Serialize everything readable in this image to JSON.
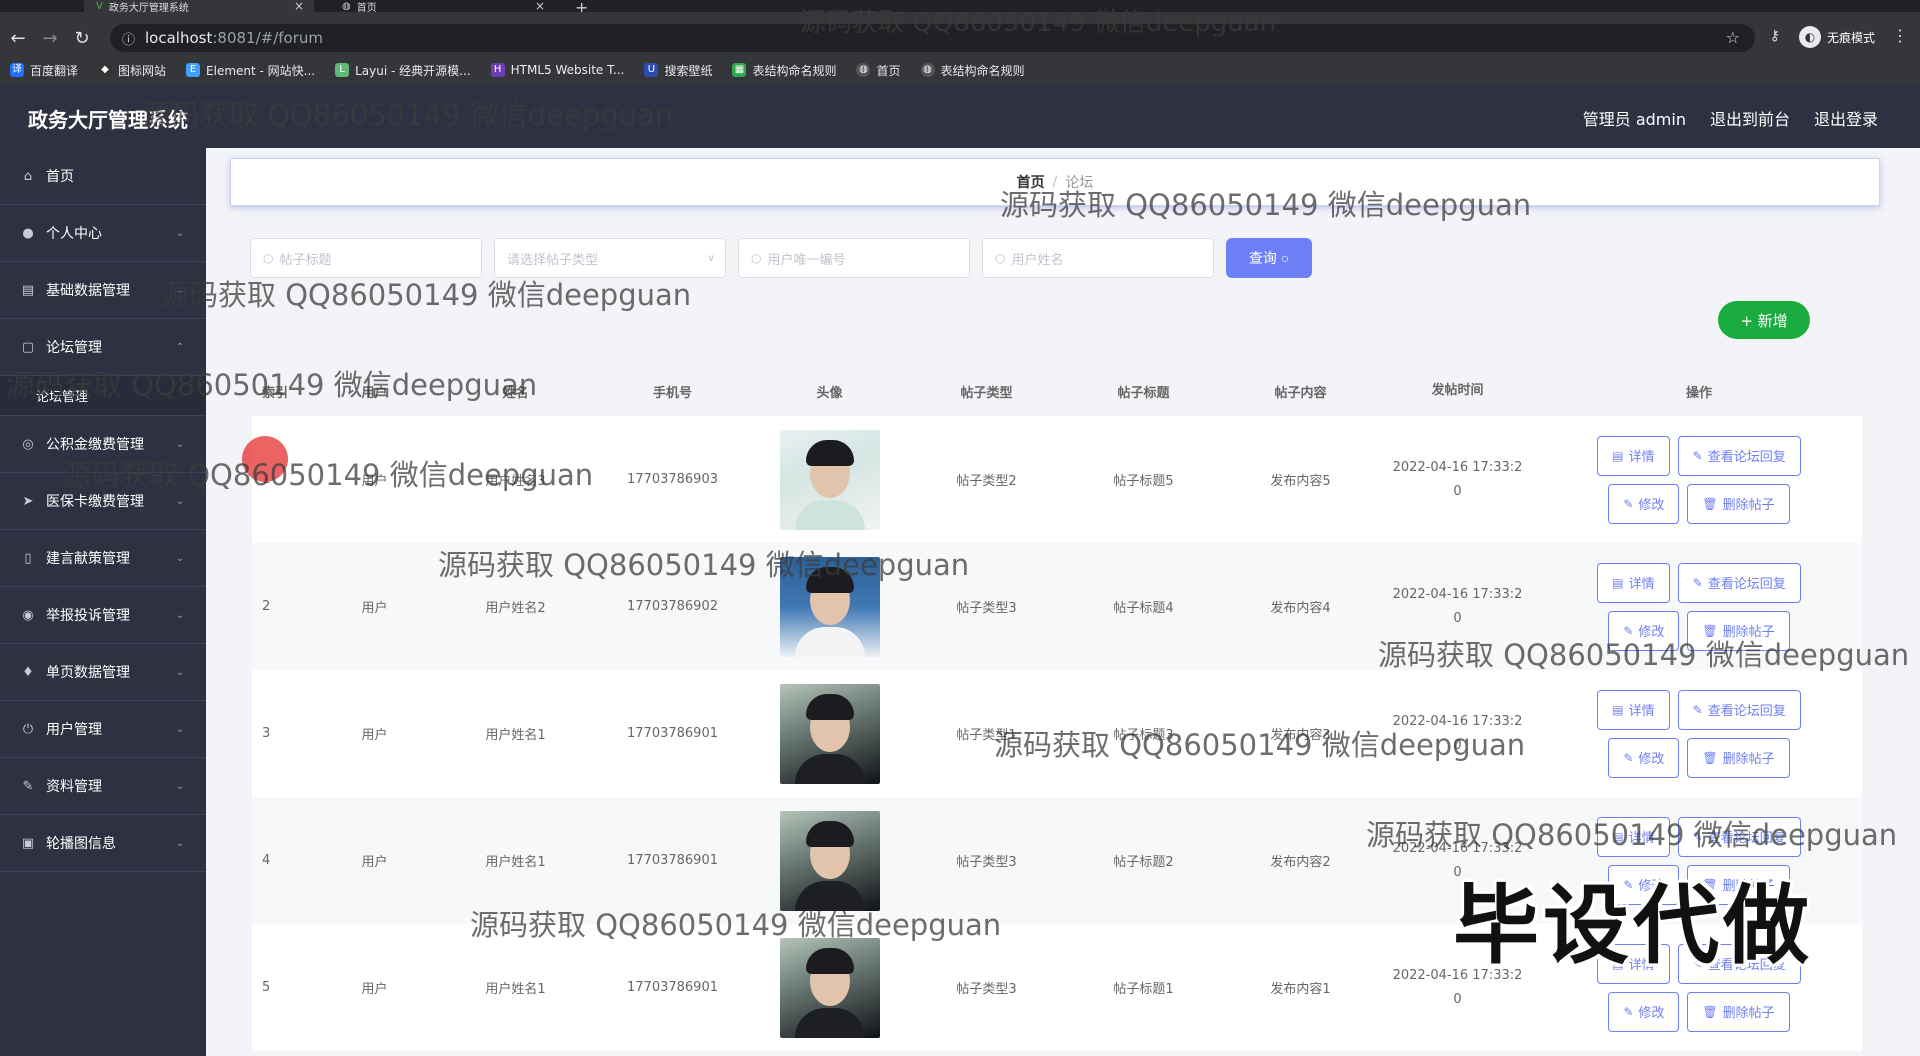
{
  "browser": {
    "tabs": [
      {
        "title": "政务大厅管理系统",
        "active": true
      },
      {
        "title": "首页",
        "active": false
      }
    ],
    "url": "localhost:8081/#/forum",
    "url_host": "localhost",
    "url_rest": ":8081/#/forum",
    "profile_label": "无痕模式",
    "bookmarks": [
      {
        "label": "百度翻译",
        "color": "#1e6fff"
      },
      {
        "label": "图标网站",
        "color": "#333333"
      },
      {
        "label": "Element - 网站快...",
        "color": "#409eff"
      },
      {
        "label": "Layui - 经典开源模...",
        "color": "#5fb878"
      },
      {
        "label": "HTML5 Website T...",
        "color": "#6c3fb5"
      },
      {
        "label": "搜索壁纸",
        "color": "#2b4bb5"
      },
      {
        "label": "表结构命名规则",
        "color": "#2fa64f"
      },
      {
        "label": "首页",
        "color": "#555555"
      },
      {
        "label": "表结构命名规则",
        "color": "#555555"
      }
    ]
  },
  "header": {
    "title": "政务大厅管理系统",
    "admin_label": "管理员 admin",
    "to_front_label": "退出到前台",
    "logout_label": "退出登录"
  },
  "sidebar": {
    "items": [
      {
        "label": "首页",
        "icon": "home-icon",
        "glyph": "⌂"
      },
      {
        "label": "个人中心",
        "icon": "user-icon",
        "glyph": "●"
      },
      {
        "label": "基础数据管理",
        "icon": "list-icon",
        "glyph": "▤"
      },
      {
        "label": "论坛管理",
        "icon": "forum-icon",
        "glyph": "▢"
      },
      {
        "label": "论坛管理",
        "icon": "",
        "glyph": ""
      },
      {
        "label": "公积金缴费管理",
        "icon": "coin-icon",
        "glyph": "◎"
      },
      {
        "label": "医保卡缴费管理",
        "icon": "send-icon",
        "glyph": "➤"
      },
      {
        "label": "建言献策管理",
        "icon": "phone-icon",
        "glyph": "▯"
      },
      {
        "label": "举报投诉管理",
        "icon": "target-icon",
        "glyph": "◉"
      },
      {
        "label": "单页数据管理",
        "icon": "location-icon",
        "glyph": "♦"
      },
      {
        "label": "用户管理",
        "icon": "power-icon",
        "glyph": "⏻"
      },
      {
        "label": "资料管理",
        "icon": "tool-icon",
        "glyph": "✎"
      },
      {
        "label": "轮播图信息",
        "icon": "image-icon",
        "glyph": "▣"
      }
    ]
  },
  "breadcrumb": {
    "home": "首页",
    "separator": "/",
    "current": "论坛"
  },
  "search": {
    "title_placeholder": "帖子标题",
    "type_placeholder": "请选择帖子类型",
    "user_id_placeholder": "用户唯一编号",
    "user_name_placeholder": "用户姓名",
    "query_label": "查询"
  },
  "add_label": "+ 新增",
  "table": {
    "headers": [
      "索引",
      "用户",
      "姓名",
      "手机号",
      "头像",
      "帖子类型",
      "帖子标题",
      "帖子内容",
      "发帖时间",
      "操作"
    ],
    "rows": [
      {
        "index": "1",
        "type": "用户",
        "name": "用户姓名3",
        "phone": "17703786903",
        "avatar": "a1",
        "post_type": "帖子类型2",
        "post_title": "帖子标题5",
        "content": "发布内容5",
        "time_a": "2022-04-16 17:33:2",
        "time_b": "0"
      },
      {
        "index": "2",
        "type": "用户",
        "name": "用户姓名2",
        "phone": "17703786902",
        "avatar": "a2",
        "post_type": "帖子类型3",
        "post_title": "帖子标题4",
        "content": "发布内容4",
        "time_a": "2022-04-16 17:33:2",
        "time_b": "0"
      },
      {
        "index": "3",
        "type": "用户",
        "name": "用户姓名1",
        "phone": "17703786901",
        "avatar": "a3",
        "post_type": "帖子类型1",
        "post_title": "帖子标题3",
        "content": "发布内容3",
        "time_a": "2022-04-16 17:33:2",
        "time_b": "0"
      },
      {
        "index": "4",
        "type": "用户",
        "name": "用户姓名1",
        "phone": "17703786901",
        "avatar": "a3",
        "post_type": "帖子类型3",
        "post_title": "帖子标题2",
        "content": "发布内容2",
        "time_a": "2022-04-16 17:33:2",
        "time_b": "0"
      },
      {
        "index": "5",
        "type": "用户",
        "name": "用户姓名1",
        "phone": "17703786901",
        "avatar": "a3",
        "post_type": "帖子类型3",
        "post_title": "帖子标题1",
        "content": "发布内容1",
        "time_a": "2022-04-16 17:33:2",
        "time_b": "0"
      }
    ],
    "ops": {
      "detail": "详情",
      "view_replies": "查看论坛回复",
      "edit": "修改",
      "delete": "删除帖子"
    }
  },
  "watermark_text": "源码获取 QQ86050149 微信deepguan",
  "stamp_text": "毕设代做",
  "colors": {
    "primary": "#6d7ff6",
    "success": "#1aac3e",
    "sidebar": "#2d3142"
  }
}
